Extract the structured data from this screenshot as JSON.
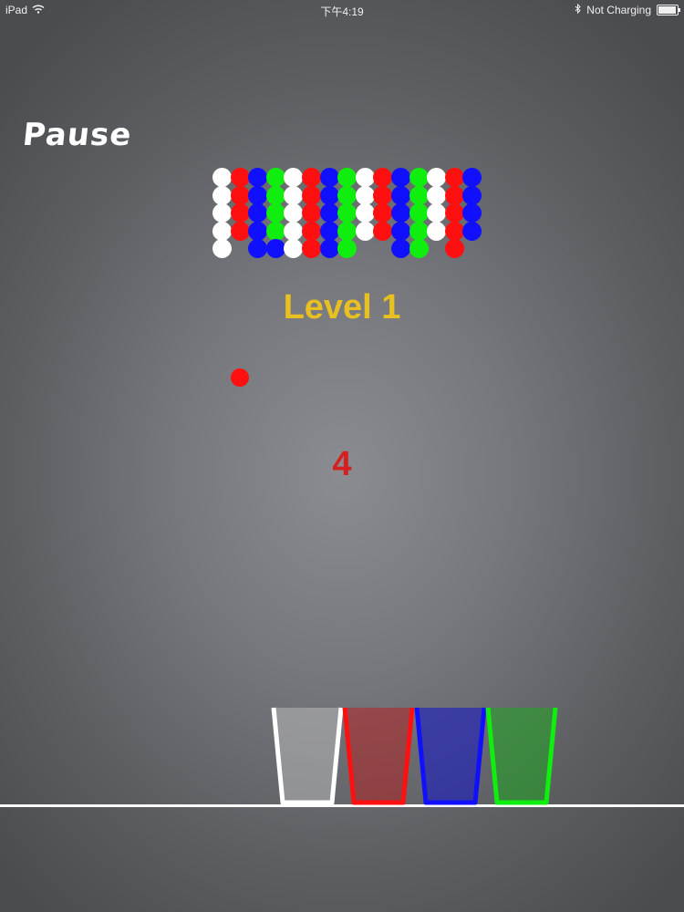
{
  "status_bar": {
    "device": "iPad",
    "time": "下午4:19",
    "charging": "Not Charging"
  },
  "pause_label": "Pause",
  "level_label": "Level 1",
  "countdown": "4",
  "colors": {
    "white": "#ffffff",
    "red": "#ff1010",
    "blue": "#1010ff",
    "green": "#10ee10"
  },
  "ball_grid": {
    "columns": [
      [
        "white",
        "white",
        "white",
        "white",
        "white"
      ],
      [
        "red",
        "red",
        "red",
        "red",
        ""
      ],
      [
        "blue",
        "blue",
        "blue",
        "blue",
        "blue"
      ],
      [
        "green",
        "green",
        "green",
        "green",
        "blue"
      ],
      [
        "white",
        "white",
        "white",
        "white",
        "white"
      ],
      [
        "red",
        "red",
        "red",
        "red",
        "red"
      ],
      [
        "blue",
        "blue",
        "blue",
        "blue",
        "blue"
      ],
      [
        "green",
        "green",
        "green",
        "green",
        "green"
      ],
      [
        "white",
        "white",
        "white",
        "white",
        ""
      ],
      [
        "red",
        "red",
        "red",
        "red",
        ""
      ],
      [
        "blue",
        "blue",
        "blue",
        "blue",
        "blue"
      ],
      [
        "green",
        "green",
        "green",
        "green",
        "green"
      ],
      [
        "white",
        "white",
        "white",
        "white",
        ""
      ],
      [
        "red",
        "red",
        "red",
        "red",
        "red"
      ],
      [
        "blue",
        "blue",
        "blue",
        "blue",
        ""
      ]
    ]
  },
  "falling_ball_color": "red",
  "cups": [
    {
      "name": "white",
      "border": "#ffffff",
      "fill": "rgba(200,200,200,0.45)"
    },
    {
      "name": "red",
      "border": "#ff1010",
      "fill": "rgba(190,20,20,0.45)"
    },
    {
      "name": "blue",
      "border": "#1010ff",
      "fill": "rgba(20,20,200,0.55)"
    },
    {
      "name": "green",
      "border": "#10ee10",
      "fill": "rgba(20,180,20,0.45)"
    }
  ]
}
